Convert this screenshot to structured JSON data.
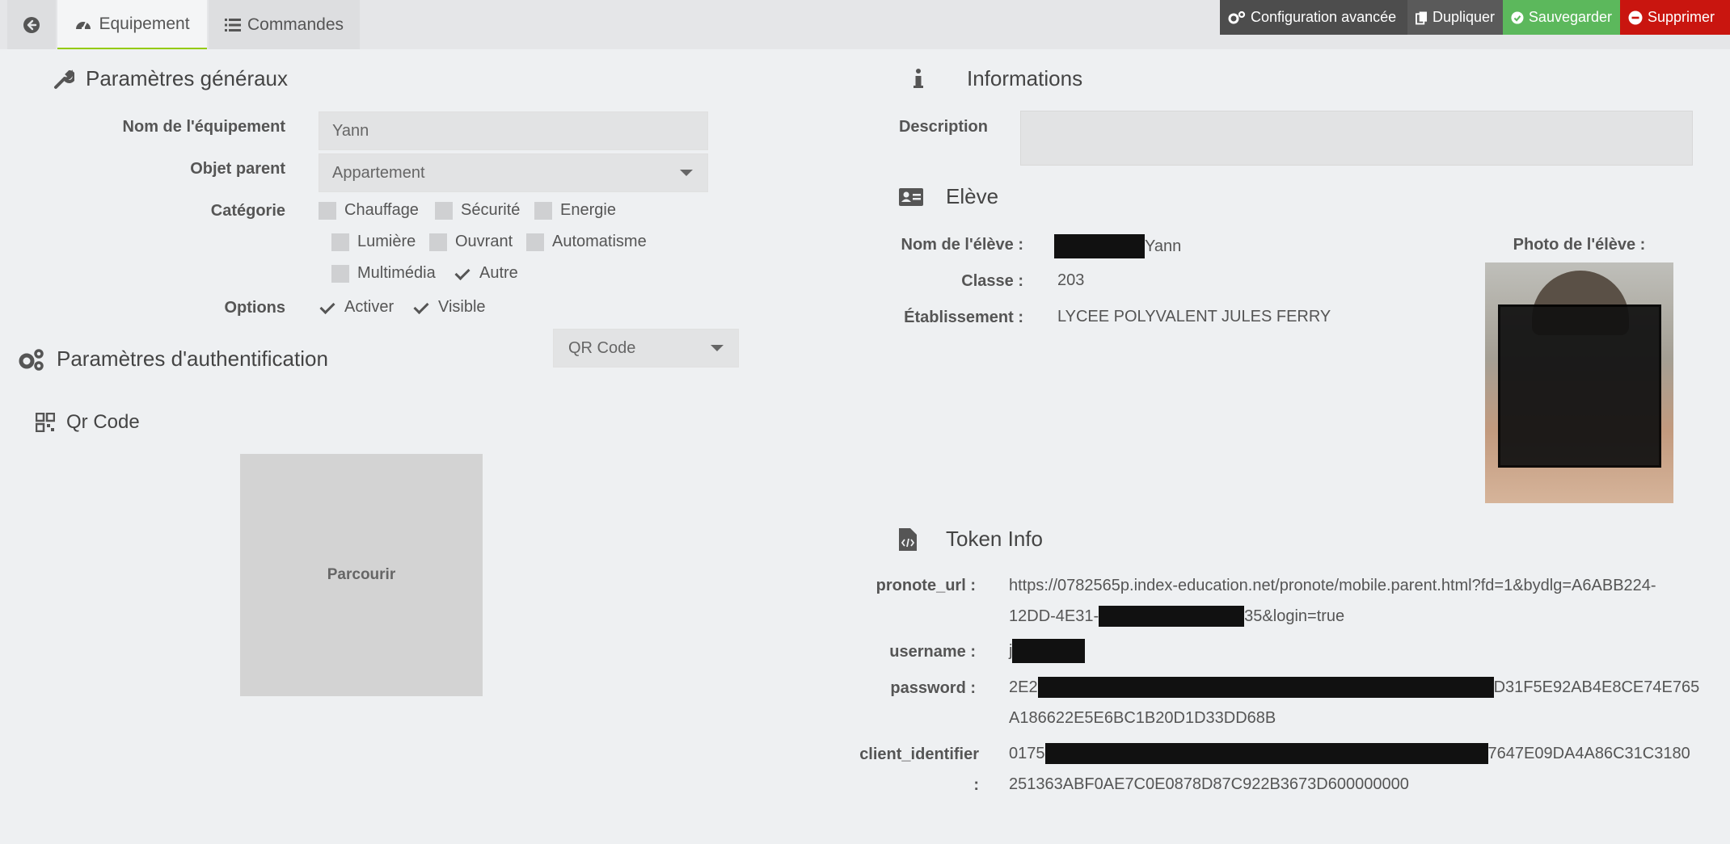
{
  "tabs": {
    "back_icon": "arrow-left-circle-icon",
    "equipement": "Equipement",
    "commandes": "Commandes"
  },
  "toolbar": {
    "config": "Configuration avancée",
    "dupliquer": "Dupliquer",
    "sauvegarder": "Sauvegarder",
    "supprimer": "Supprimer"
  },
  "general": {
    "title": "Paramètres généraux",
    "name_label": "Nom de l'équipement",
    "name_value": "Yann",
    "parent_label": "Objet parent",
    "parent_value": "Appartement",
    "category_label": "Catégorie",
    "categories": [
      {
        "label": "Chauffage",
        "checked": false
      },
      {
        "label": "Sécurité",
        "checked": false
      },
      {
        "label": "Energie",
        "checked": false
      },
      {
        "label": "Lumière",
        "checked": false
      },
      {
        "label": "Ouvrant",
        "checked": false
      },
      {
        "label": "Automatisme",
        "checked": false
      },
      {
        "label": "Multimédia",
        "checked": false
      },
      {
        "label": "Autre",
        "checked": true
      }
    ],
    "options_label": "Options",
    "options": [
      {
        "label": "Activer",
        "checked": true
      },
      {
        "label": "Visible",
        "checked": true
      }
    ]
  },
  "auth": {
    "title": "Paramètres d'authentification",
    "mode_value": "QR Code",
    "qr_title": "Qr Code",
    "browse": "Parcourir"
  },
  "info": {
    "title": "Informations",
    "description_label": "Description",
    "description_value": ""
  },
  "eleve": {
    "title": "Elève",
    "name_label": "Nom de l'élève :",
    "name_value": "Yann",
    "classe_label": "Classe :",
    "classe_value": "203",
    "etab_label": "Établissement :",
    "etab_value": "LYCEE POLYVALENT JULES FERRY",
    "photo_label": "Photo de l'élève :"
  },
  "token": {
    "title": "Token Info",
    "url_label": "pronote_url :",
    "url_line1": "https://0782565p.index-education.net/pronote/mobile.parent.html?fd=1&bydlg=A6ABB224-",
    "url_line2_a": "12DD-4E31-",
    "url_line2_b": "35&login=true",
    "username_label": "username :",
    "username_prefix": "j",
    "password_label": "password :",
    "password_line1_a": "2E2",
    "password_line1_b": "D31F5E92AB4E8CE74E765",
    "password_line2": "A186622E5E6BC1B20D1D33DD68B",
    "client_label_a": "client_identifier",
    "client_label_b": ":",
    "client_line1_a": "0175",
    "client_line1_b": "7647E09DA4A86C31C3180",
    "client_line2": "251363ABF0AE7C0E0878D87C922B3673D600000000"
  },
  "colors": {
    "accent": "#94ca02",
    "save": "#5cb85c",
    "delete": "#c9150f",
    "toolbar_dark": "#4d4d4d"
  }
}
